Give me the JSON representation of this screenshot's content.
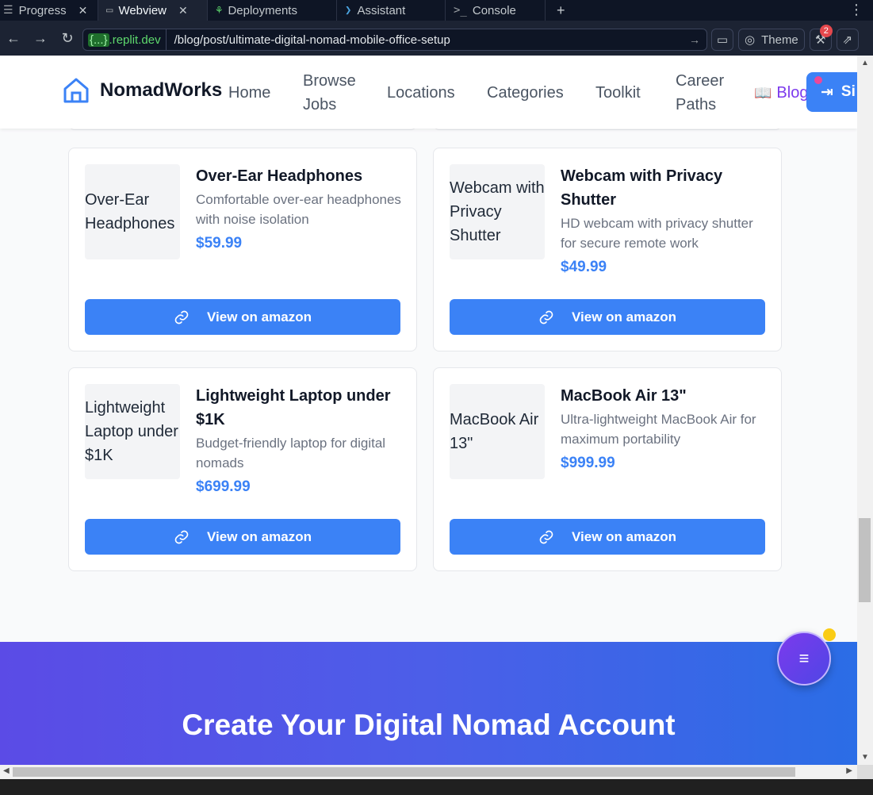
{
  "ide": {
    "tabs": [
      {
        "label": "Progress",
        "icon": "progress-icon",
        "closable": true,
        "active": false
      },
      {
        "label": "Webview",
        "icon": "monitor-icon",
        "closable": true,
        "active": true
      },
      {
        "label": "Deployments",
        "icon": "deploy-icon",
        "closable": false,
        "active": false
      },
      {
        "label": "Assistant",
        "icon": "assistant-icon",
        "closable": false,
        "active": false
      },
      {
        "label": "Console",
        "icon": "terminal-icon",
        "closable": false,
        "active": false
      }
    ],
    "address": {
      "host_prefix": "{...}",
      "host": ".replit.dev",
      "path": "/blog/post/ultimate-digital-nomad-mobile-office-setup"
    },
    "theme_label": "Theme",
    "notification_count": "2"
  },
  "site": {
    "brand": "NomadWorks",
    "nav": {
      "home": "Home",
      "browse_jobs_1": "Browse",
      "browse_jobs_2": "Jobs",
      "locations": "Locations",
      "categories": "Categories",
      "toolkit": "Toolkit",
      "career_1": "Career",
      "career_2": "Paths",
      "blog": "Blog",
      "signin": "Si"
    },
    "products": [
      {
        "name": "Over-Ear Headphones",
        "alt": "Over-Ear Headphones",
        "description": "Comfortable over-ear headphones with noise isolation",
        "price": "$59.99",
        "button": "View on amazon"
      },
      {
        "name": "Webcam with Privacy Shutter",
        "alt": "Webcam with Privacy Shutter",
        "description": "HD webcam with privacy shutter for secure remote work",
        "price": "$49.99",
        "button": "View on amazon"
      },
      {
        "name": "Lightweight Laptop under $1K",
        "alt": "Lightweight Laptop under $1K",
        "description": "Budget-friendly laptop for digital nomads",
        "price": "$699.99",
        "button": "View on amazon"
      },
      {
        "name": "MacBook Air 13\"",
        "alt": "MacBook Air 13\"",
        "description": "Ultra-lightweight MacBook Air for maximum portability",
        "price": "$999.99",
        "button": "View on amazon"
      }
    ],
    "cta_title": "Create Your Digital Nomad Account",
    "fab_icon": "menu-icon"
  },
  "colors": {
    "primary": "#3b82f6",
    "blog": "#7c3aed",
    "cta_from": "#5b4be6",
    "cta_to": "#2b6de6",
    "ide_bg": "#1c2333"
  }
}
